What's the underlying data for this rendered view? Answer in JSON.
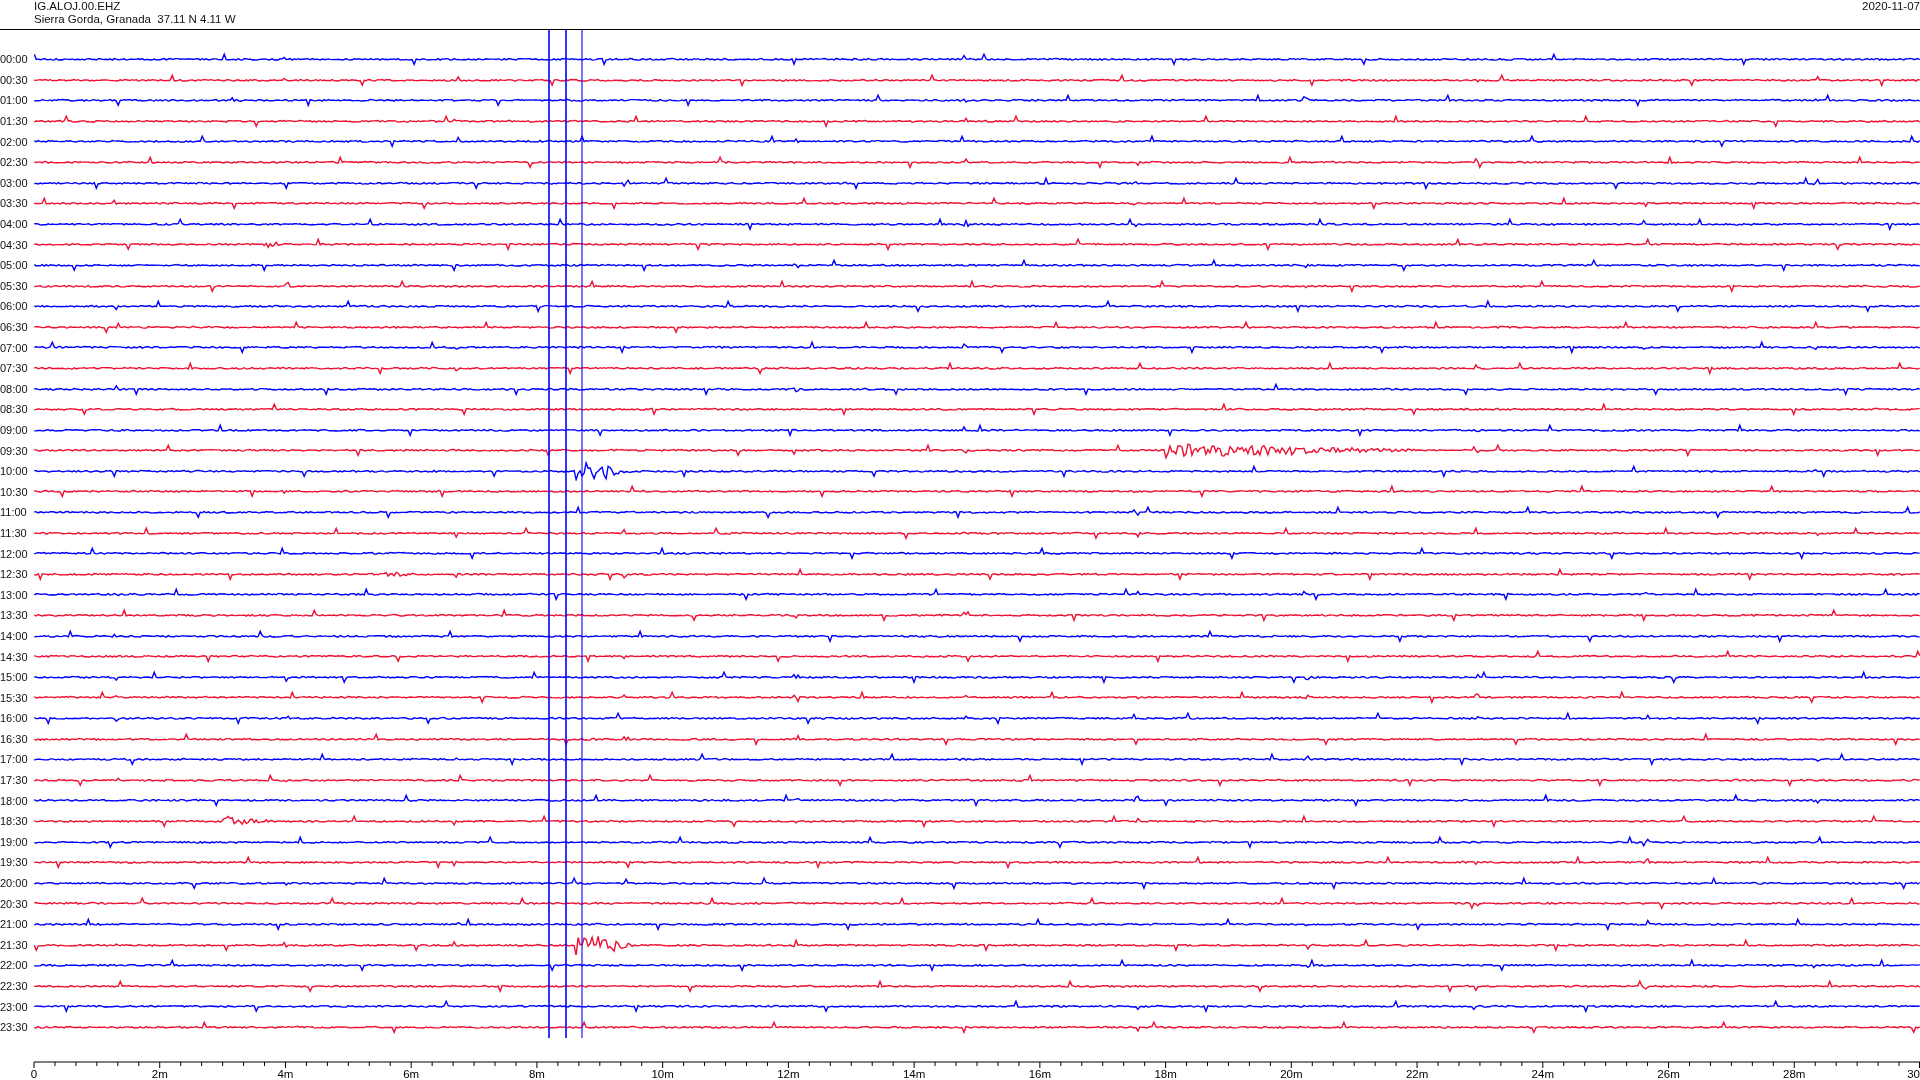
{
  "header": {
    "station": "IG.ALOJ.00.EHZ",
    "location": "Sierra Gorda, Granada  37.11 N 4.11 W",
    "date": "2020-11-07"
  },
  "rows": [
    {
      "time": "00:00",
      "color": "#0000ff"
    },
    {
      "time": "00:30",
      "color": "#ee1133"
    },
    {
      "time": "01:00",
      "color": "#0000ff"
    },
    {
      "time": "01:30",
      "color": "#ee1133"
    },
    {
      "time": "02:00",
      "color": "#0000ff"
    },
    {
      "time": "02:30",
      "color": "#ee1133"
    },
    {
      "time": "03:00",
      "color": "#0000ff"
    },
    {
      "time": "03:30",
      "color": "#ee1133"
    },
    {
      "time": "04:00",
      "color": "#0000ff"
    },
    {
      "time": "04:30",
      "color": "#ee1133"
    },
    {
      "time": "05:00",
      "color": "#0000ff"
    },
    {
      "time": "05:30",
      "color": "#ee1133"
    },
    {
      "time": "06:00",
      "color": "#0000ff"
    },
    {
      "time": "06:30",
      "color": "#ee1133"
    },
    {
      "time": "07:00",
      "color": "#0000ff"
    },
    {
      "time": "07:30",
      "color": "#ee1133"
    },
    {
      "time": "08:00",
      "color": "#0000ff"
    },
    {
      "time": "08:30",
      "color": "#ee1133"
    },
    {
      "time": "09:00",
      "color": "#0000ff"
    },
    {
      "time": "09:30",
      "color": "#ee1133"
    },
    {
      "time": "10:00",
      "color": "#0000ff"
    },
    {
      "time": "10:30",
      "color": "#ee1133"
    },
    {
      "time": "11:00",
      "color": "#0000ff"
    },
    {
      "time": "11:30",
      "color": "#ee1133"
    },
    {
      "time": "12:00",
      "color": "#0000ff"
    },
    {
      "time": "12:30",
      "color": "#ee1133"
    },
    {
      "time": "13:00",
      "color": "#0000ff"
    },
    {
      "time": "13:30",
      "color": "#ee1133"
    },
    {
      "time": "14:00",
      "color": "#0000ff"
    },
    {
      "time": "14:30",
      "color": "#ee1133"
    },
    {
      "time": "15:00",
      "color": "#0000ff"
    },
    {
      "time": "15:30",
      "color": "#ee1133"
    },
    {
      "time": "16:00",
      "color": "#0000ff"
    },
    {
      "time": "16:30",
      "color": "#ee1133"
    },
    {
      "time": "17:00",
      "color": "#0000ff"
    },
    {
      "time": "17:30",
      "color": "#ee1133"
    },
    {
      "time": "18:00",
      "color": "#0000ff"
    },
    {
      "time": "18:30",
      "color": "#ee1133"
    },
    {
      "time": "19:00",
      "color": "#0000ff"
    },
    {
      "time": "19:30",
      "color": "#ee1133"
    },
    {
      "time": "20:00",
      "color": "#0000ff"
    },
    {
      "time": "20:30",
      "color": "#ee1133"
    },
    {
      "time": "21:00",
      "color": "#0000ff"
    },
    {
      "time": "21:30",
      "color": "#ee1133"
    },
    {
      "time": "22:00",
      "color": "#0000ff"
    },
    {
      "time": "22:30",
      "color": "#ee1133"
    },
    {
      "time": "23:00",
      "color": "#0000ff"
    },
    {
      "time": "23:30",
      "color": "#ee1133"
    }
  ],
  "x_axis": {
    "labels": [
      "0",
      "2m",
      "4m",
      "6m",
      "8m",
      "10m",
      "12m",
      "14m",
      "16m",
      "18m",
      "20m",
      "22m",
      "24m",
      "26m",
      "28m",
      "30"
    ]
  }
}
